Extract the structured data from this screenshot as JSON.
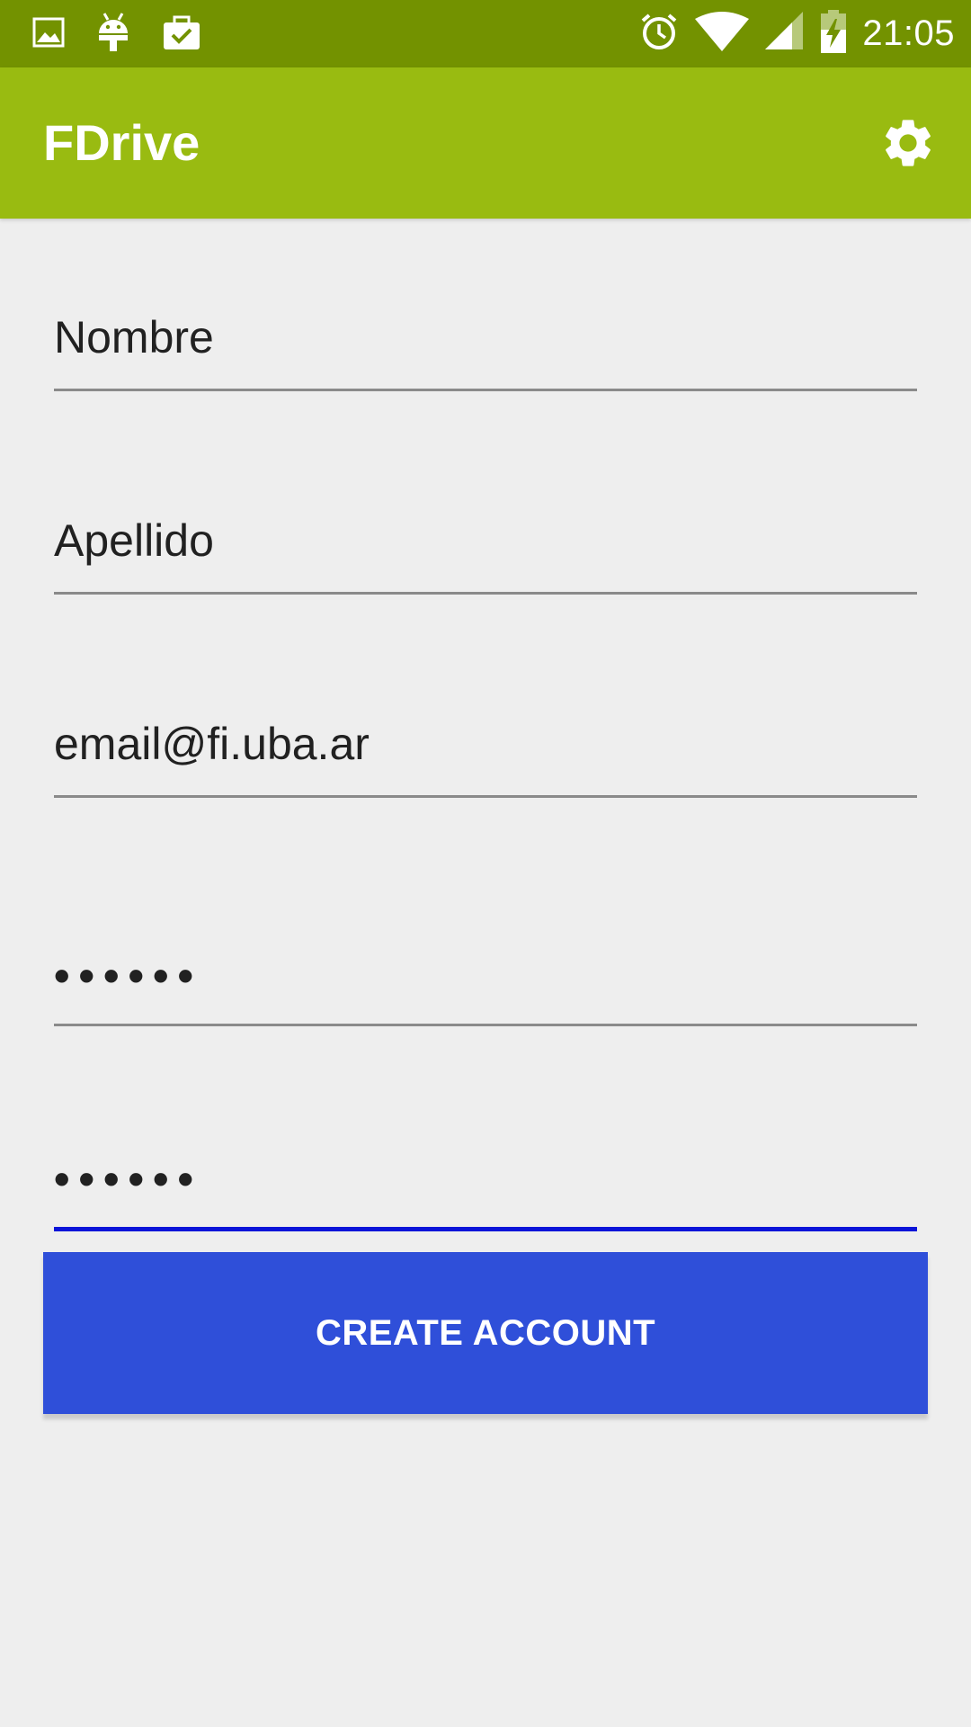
{
  "status_bar": {
    "time": "21:05",
    "left_icons": [
      "image-icon",
      "android-icon",
      "briefcase-check-icon"
    ],
    "right_icons": [
      "alarm-icon",
      "wifi-icon",
      "cell-signal-icon",
      "battery-charging-icon"
    ]
  },
  "app_bar": {
    "title": "FDrive",
    "settings_icon": "gear-icon"
  },
  "form": {
    "first_name": "Nombre",
    "last_name": "Apellido",
    "email": "email@fi.uba.ar",
    "password": "••••••",
    "confirm_password": "••••••"
  },
  "create_button": {
    "label": "CREATE ACCOUNT"
  },
  "colors": {
    "status_bar": "#739200",
    "app_bar": "#99bb11",
    "button": "#2f4fd9",
    "focused_underline": "#0a14d8",
    "background": "#eeeeee"
  }
}
